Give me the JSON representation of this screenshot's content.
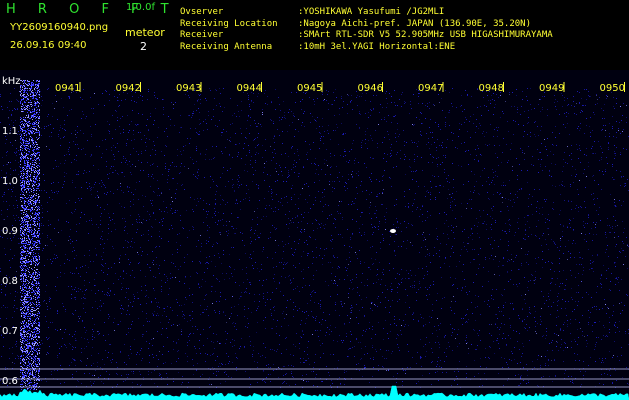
{
  "header": {
    "brand": "H R O F F T",
    "version": "1.0.0f",
    "filename": "YY2609160940.png",
    "timestamp": "26.09.16 09:40",
    "meteor_label": "meteor",
    "meteor_count": "2",
    "meta": [
      {
        "key": "Ovserver",
        "value": ":YOSHIKAWA Yasufumi /JG2MLI"
      },
      {
        "key": "Receiving Location",
        "value": ":Nagoya Aichi-pref. JAPAN (136.90E, 35.20N)"
      },
      {
        "key": "Receiver",
        "value": ":SMArt RTL-SDR V5 52.905MHz USB HIGASHIMURAYAMA"
      },
      {
        "key": "Receiving Antenna",
        "value": ":10mH 3el.YAGI Horizontal:ENE"
      }
    ]
  },
  "spectrogram": {
    "freq_unit": "kHz",
    "freq_labels": [
      "1.1",
      "1.0",
      "0.9",
      "0.8",
      "0.7",
      "0.6"
    ],
    "time_labels": [
      "0941",
      "0942",
      "0943",
      "0944",
      "0945",
      "0946",
      "0947",
      "0948",
      "0949",
      "0950"
    ],
    "colors": {
      "background": "#000010",
      "noise": "#1e1ec8",
      "signal": "#ffffff",
      "tick": "#ffff33",
      "trace": "#00ffff"
    }
  }
}
